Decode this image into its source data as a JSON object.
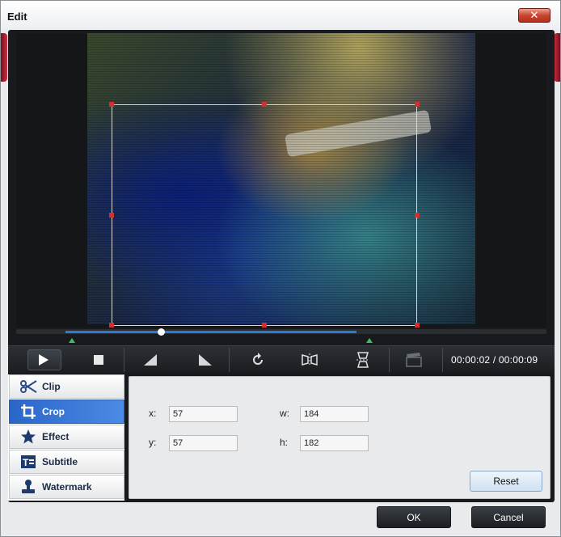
{
  "window": {
    "title": "Edit",
    "close_label": "✕"
  },
  "player": {
    "time_display": "00:00:02 / 00:00:09",
    "progress": 0.28
  },
  "tabs": [
    {
      "label": "Clip",
      "icon": "scissors-icon"
    },
    {
      "label": "Crop",
      "icon": "crop-icon"
    },
    {
      "label": "Effect",
      "icon": "star-icon"
    },
    {
      "label": "Subtitle",
      "icon": "subtitle-icon"
    },
    {
      "label": "Watermark",
      "icon": "stamp-icon"
    }
  ],
  "crop": {
    "x_label": "x:",
    "x_value": "57",
    "y_label": "y:",
    "y_value": "57",
    "w_label": "w:",
    "w_value": "184",
    "h_label": "h:",
    "h_value": "182",
    "reset_label": "Reset"
  },
  "footer": {
    "ok_label": "OK",
    "cancel_label": "Cancel"
  },
  "colors": {
    "accent": "#2a66c8",
    "close": "#c9452f",
    "crop_handle": "#d13030"
  }
}
